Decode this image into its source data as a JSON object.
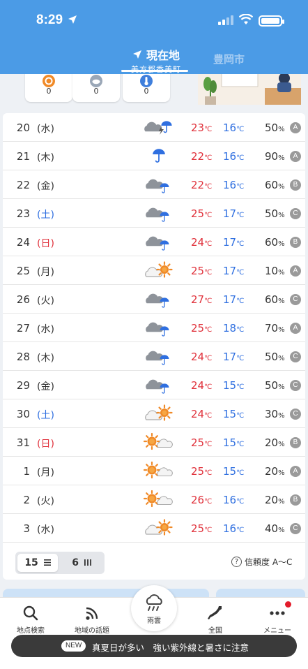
{
  "status": {
    "time": "8:29"
  },
  "tabs": {
    "current_label": "現在地",
    "current_sub": "美方郡香美町",
    "other_label": "豊岡市"
  },
  "top_cards": [
    {
      "icon": "sun-alert-icon",
      "value": "0",
      "color": "#f08a28"
    },
    {
      "icon": "cloud-icon",
      "value": "0",
      "color": "#9aa7b7"
    },
    {
      "icon": "thermometer-icon",
      "value": "0",
      "color": "#3f7fdc"
    }
  ],
  "forecast": [
    {
      "date": "20",
      "dow": "(水)",
      "type": "weekday",
      "weather": "cloudy-thunder-rain",
      "hi": "23",
      "lo": "16",
      "pop": "50",
      "rel": "A"
    },
    {
      "date": "21",
      "dow": "(木)",
      "type": "weekday",
      "weather": "rain",
      "hi": "22",
      "lo": "16",
      "pop": "90",
      "rel": "A"
    },
    {
      "date": "22",
      "dow": "(金)",
      "type": "weekday",
      "weather": "cloudy-rain",
      "hi": "22",
      "lo": "16",
      "pop": "60",
      "rel": "B"
    },
    {
      "date": "23",
      "dow": "(土)",
      "type": "sat",
      "weather": "cloudy-rain",
      "hi": "25",
      "lo": "17",
      "pop": "50",
      "rel": "C"
    },
    {
      "date": "24",
      "dow": "(日)",
      "type": "sun",
      "weather": "cloudy-rain",
      "hi": "24",
      "lo": "17",
      "pop": "60",
      "rel": "B"
    },
    {
      "date": "25",
      "dow": "(月)",
      "type": "weekday",
      "weather": "cloudy-sunny",
      "hi": "25",
      "lo": "17",
      "pop": "10",
      "rel": "A"
    },
    {
      "date": "26",
      "dow": "(火)",
      "type": "weekday",
      "weather": "cloudy-rain",
      "hi": "27",
      "lo": "17",
      "pop": "60",
      "rel": "C"
    },
    {
      "date": "27",
      "dow": "(水)",
      "type": "weekday",
      "weather": "cloudy-rain",
      "hi": "25",
      "lo": "18",
      "pop": "70",
      "rel": "A"
    },
    {
      "date": "28",
      "dow": "(木)",
      "type": "weekday",
      "weather": "cloudy-rain",
      "hi": "24",
      "lo": "17",
      "pop": "50",
      "rel": "C"
    },
    {
      "date": "29",
      "dow": "(金)",
      "type": "weekday",
      "weather": "cloudy-rain",
      "hi": "24",
      "lo": "15",
      "pop": "50",
      "rel": "C"
    },
    {
      "date": "30",
      "dow": "(土)",
      "type": "sat",
      "weather": "cloudy-sunny",
      "hi": "24",
      "lo": "15",
      "pop": "30",
      "rel": "C"
    },
    {
      "date": "31",
      "dow": "(日)",
      "type": "sun",
      "weather": "sunny-cloudy",
      "hi": "25",
      "lo": "15",
      "pop": "20",
      "rel": "B"
    },
    {
      "date": "1",
      "dow": "(月)",
      "type": "weekday",
      "weather": "sunny-cloudy",
      "hi": "25",
      "lo": "15",
      "pop": "20",
      "rel": "A"
    },
    {
      "date": "2",
      "dow": "(火)",
      "type": "weekday",
      "weather": "sunny-cloudy",
      "hi": "26",
      "lo": "16",
      "pop": "20",
      "rel": "B"
    },
    {
      "date": "3",
      "dow": "(水)",
      "type": "weekday",
      "weather": "cloudy-sunny",
      "hi": "25",
      "lo": "16",
      "pop": "40",
      "rel": "C"
    }
  ],
  "units": {
    "temp": "℃",
    "pct": "%"
  },
  "range_toggle": {
    "opt1": "15",
    "opt2": "6"
  },
  "reliability_label": "信頼度 A〜C",
  "bottom_nav": {
    "search": "地点検索",
    "local": "地域の話題",
    "rain": "雨雲",
    "national": "全国",
    "menu": "メニュー"
  },
  "news": {
    "badge": "NEW",
    "text": "真夏日が多い　強い紫外線と暑さに注意"
  },
  "colors": {
    "header": "#4b9be6",
    "hi": "#e0313b",
    "lo": "#2f6fe0",
    "sun": "#f08a28",
    "umbrella": "#2f6fe0"
  }
}
